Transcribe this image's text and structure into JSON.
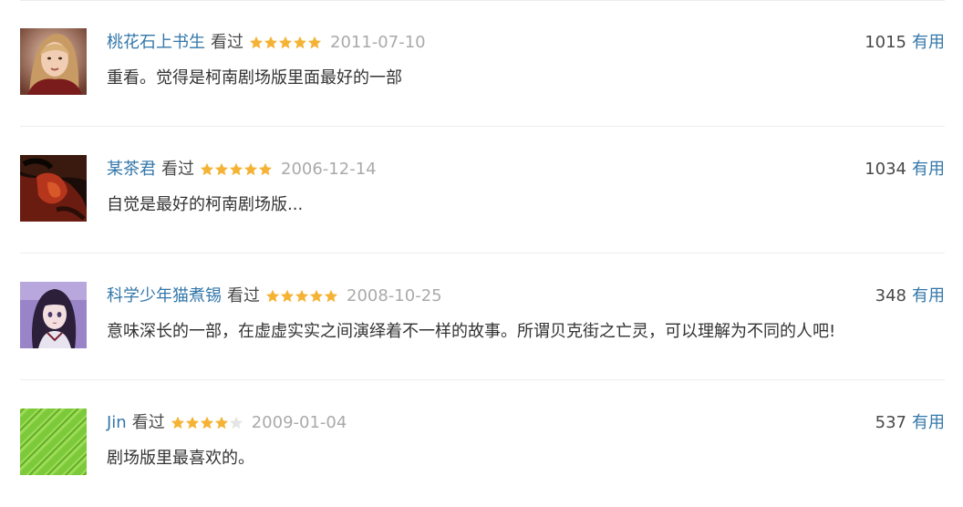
{
  "comments": [
    {
      "username": "桃花石上书生",
      "status": "看过",
      "rating": 5,
      "date": "2011-07-10",
      "votes": "1015",
      "vote_label": "有用",
      "content": "重看。觉得是柯南剧场版里面最好的一部",
      "avatar_icon": "avatar-portrait-blonde-woman"
    },
    {
      "username": "某茶君",
      "status": "看过",
      "rating": 5,
      "date": "2006-12-14",
      "votes": "1034",
      "vote_label": "有用",
      "content": "自觉是最好的柯南剧场版...",
      "avatar_icon": "avatar-dark-red-portrait"
    },
    {
      "username": "科学少年猫煮锡",
      "status": "看过",
      "rating": 5,
      "date": "2008-10-25",
      "votes": "348",
      "vote_label": "有用",
      "content": "意味深长的一部，在虚虚实实之间演绎着不一样的故事。所谓贝克街之亡灵，可以理解为不同的人吧!",
      "avatar_icon": "avatar-anime-girl"
    },
    {
      "username": "Jin",
      "status": "看过",
      "rating": 4,
      "date": "2009-01-04",
      "votes": "537",
      "vote_label": "有用",
      "content": "剧场版里最喜欢的。",
      "avatar_icon": "avatar-green-pattern"
    }
  ],
  "colors": {
    "link": "#3377aa",
    "text": "#333333",
    "muted": "#aaaaaa",
    "star_filled": "#f5b335",
    "star_empty": "#e5e5e5",
    "divider": "#ececec"
  }
}
